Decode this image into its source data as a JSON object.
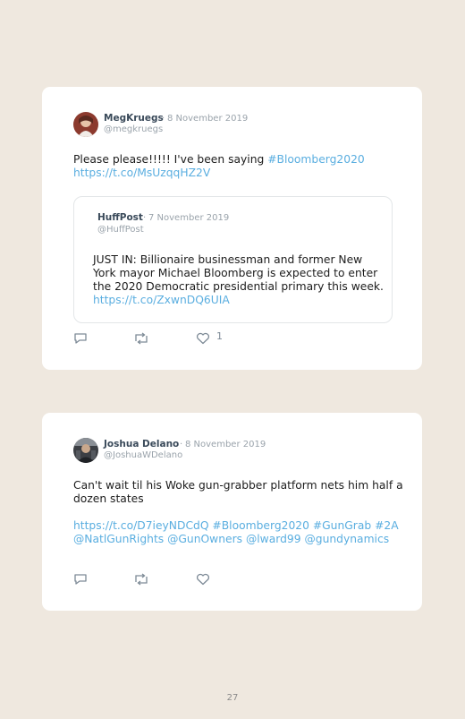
{
  "tweets": [
    {
      "name": "MegKruegs",
      "dot": "·",
      "date": "8 November 2019",
      "handle": "@megkruegs",
      "text_plain": "Please please!!!!! I've been saying ",
      "text_hashtag": "#Bloomberg2020",
      "text_link": "https://t.co/MsUzqqHZ2V",
      "quote": {
        "name": "HuffPost",
        "dot": "·",
        "date": "7 November 2019",
        "handle": "@HuffPost",
        "text_line1": "JUST IN: Billionaire businessman and former New",
        "text_line2": "York mayor Michael Bloomberg is expected to enter",
        "text_line3": "the 2020 Democratic presidential primary this week.",
        "link": "https://t.co/ZxwnDQ6UIA"
      },
      "like_count": "1"
    },
    {
      "name": "Joshua Delano",
      "dot": "·",
      "date": "8 November 2019",
      "handle": "@JoshuaWDelano",
      "text_line1": "Can't wait til his Woke gun-grabber platform nets him half a",
      "text_line2": "dozen states",
      "links_line1": "https://t.co/D7ieyNDCdQ #Bloomberg2020 #GunGrab #2A",
      "links_line2": "@NatlGunRights @GunOwners @lward99 @gundynamics"
    }
  ],
  "page_number": "27",
  "colors": {
    "background": "#efe8df",
    "card": "#ffffff",
    "link": "#5aaee0",
    "name": "#3a4a5a",
    "meta": "#9aa3ab",
    "icon": "#7d8a96"
  },
  "icons": [
    "reply-icon",
    "retweet-icon",
    "like-icon"
  ]
}
